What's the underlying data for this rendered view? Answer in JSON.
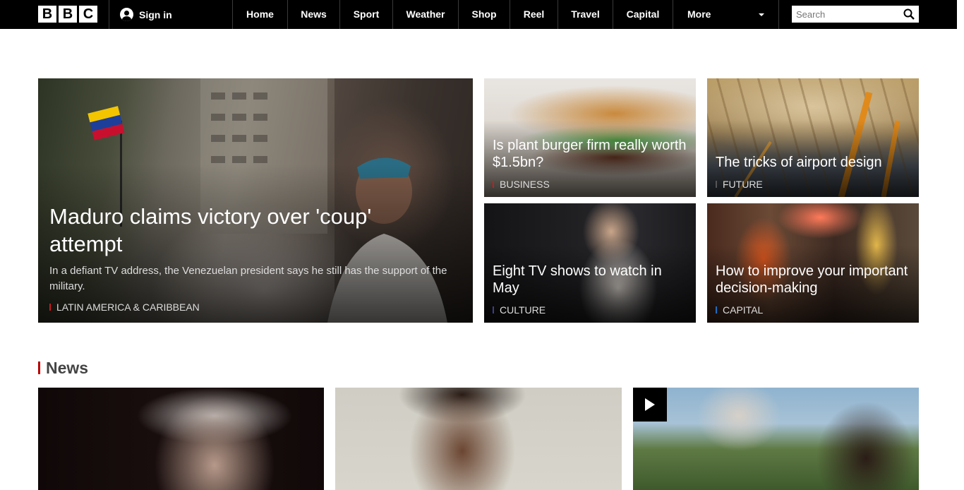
{
  "header": {
    "logo_letters": [
      "B",
      "B",
      "C"
    ],
    "signin_label": "Sign in",
    "nav": [
      {
        "label": "Home"
      },
      {
        "label": "News"
      },
      {
        "label": "Sport"
      },
      {
        "label": "Weather"
      },
      {
        "label": "Shop"
      },
      {
        "label": "Reel"
      },
      {
        "label": "Travel"
      },
      {
        "label": "Capital"
      }
    ],
    "more_label": "More",
    "search_placeholder": "Search"
  },
  "features": {
    "hero": {
      "headline": "Maduro claims victory over 'coup' attempt",
      "summary": "In a defiant TV address, the Venezuelan president says he still has the support of the military.",
      "tag": "LATIN AMERICA & CARIBBEAN",
      "tag_color": "#c91c1c"
    },
    "cards": [
      {
        "headline": "Is plant burger firm really worth $1.5bn?",
        "tag": "BUSINESS",
        "tag_color": "#c91c1c"
      },
      {
        "headline": "The tricks of airport design",
        "tag": "FUTURE",
        "tag_color": "#222222"
      },
      {
        "headline": "Eight TV shows to watch in May",
        "tag": "CULTURE",
        "tag_color": "#2e2e6b"
      },
      {
        "headline": "How to improve your important decision-making",
        "tag": "CAPITAL",
        "tag_color": "#1d6fc4"
      }
    ]
  },
  "news_section": {
    "title": "News"
  },
  "colors": {
    "nav_bg": "#000000",
    "accent_red": "#b80000"
  }
}
